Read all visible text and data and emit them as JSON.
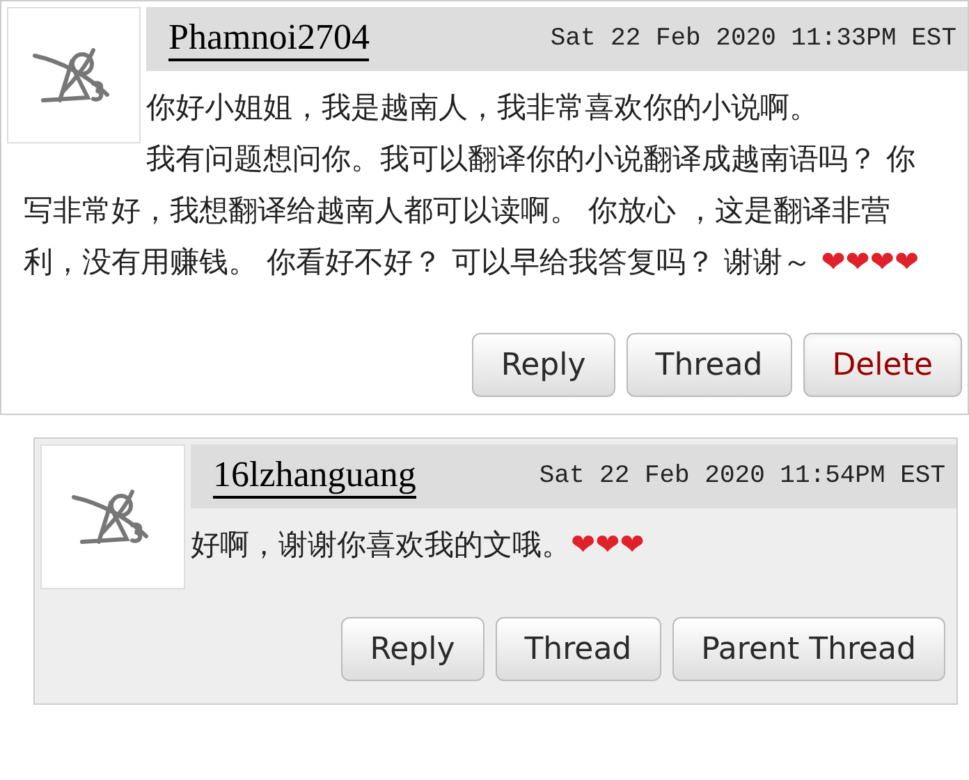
{
  "comments": [
    {
      "kind": "top",
      "username": "Phamnoi2704",
      "datetime": "Sat 22 Feb 2020 11:33PM EST",
      "paragraphs": [
        {
          "text": "你好小姐姐，我是越南人，我非常喜欢你的小说啊。"
        },
        {
          "text": "我有问题想问你。我可以翻译你的小说翻译成越南语吗？ 你写非常好，我想翻译给越南人都可以读啊。 你放心 ，这是翻译非营利，没有用赚钱。 你看好不好？ 可以早给我答复吗？ 谢谢～ ",
          "hearts": "❤❤❤❤"
        }
      ],
      "buttons": [
        {
          "label": "Reply",
          "kind": "normal"
        },
        {
          "label": "Thread",
          "kind": "normal"
        },
        {
          "label": "Delete",
          "kind": "danger"
        }
      ]
    },
    {
      "kind": "reply",
      "username": "16lzhanguang",
      "datetime": "Sat 22 Feb 2020 11:54PM EST",
      "paragraphs": [
        {
          "text": "好啊，谢谢你喜欢我的文哦。",
          "hearts": "❤❤❤"
        }
      ],
      "buttons": [
        {
          "label": "Reply",
          "kind": "normal"
        },
        {
          "label": "Thread",
          "kind": "normal"
        },
        {
          "label": "Parent Thread",
          "kind": "normal"
        }
      ]
    }
  ]
}
